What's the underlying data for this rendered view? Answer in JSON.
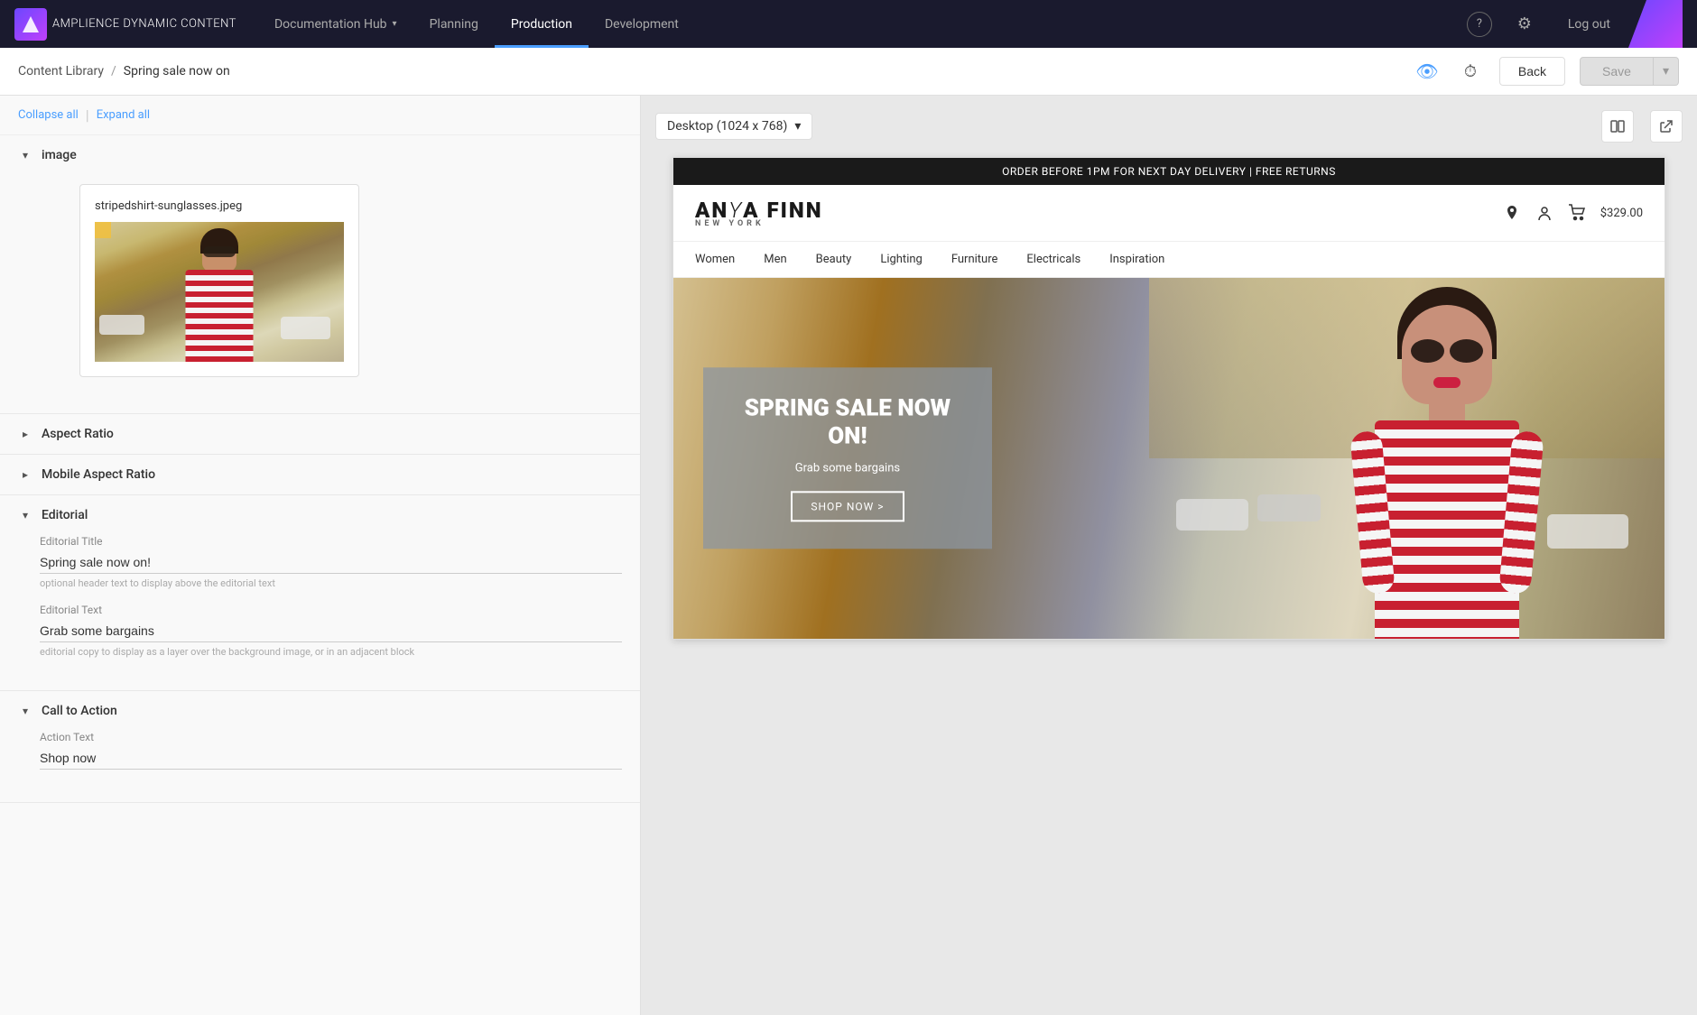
{
  "brand": {
    "name_bold": "AMPLIENCE",
    "name_light": " DYNAMIC CONTENT"
  },
  "nav": {
    "items": [
      {
        "label": "Documentation Hub",
        "active": false,
        "has_dropdown": true
      },
      {
        "label": "Planning",
        "active": false,
        "has_dropdown": false
      },
      {
        "label": "Production",
        "active": true,
        "has_dropdown": false
      },
      {
        "label": "Development",
        "active": false,
        "has_dropdown": false
      }
    ],
    "help_icon": "?",
    "settings_icon": "⚙",
    "logout_label": "Log out"
  },
  "breadcrumb": {
    "parent": "Content Library",
    "separator": "/",
    "current": "Spring sale now on",
    "back_label": "Back",
    "save_label": "Save"
  },
  "left_panel": {
    "collapse_label": "Collapse all",
    "expand_label": "Expand all",
    "sections": [
      {
        "id": "image",
        "label": "image",
        "expanded": true,
        "image_filename": "stripedshirt-sunglasses.jpeg"
      },
      {
        "id": "aspect-ratio",
        "label": "Aspect Ratio",
        "expanded": false
      },
      {
        "id": "mobile-aspect-ratio",
        "label": "Mobile Aspect Ratio",
        "expanded": false
      },
      {
        "id": "editorial",
        "label": "Editorial",
        "expanded": true,
        "fields": [
          {
            "id": "editorial-title",
            "label": "Editorial Title",
            "value": "Spring sale now on!",
            "hint": "optional header text to display above the editorial text"
          },
          {
            "id": "editorial-text",
            "label": "Editorial Text",
            "value": "Grab some bargains",
            "hint": "editorial copy to display as a layer over the background image, or in an adjacent block"
          }
        ]
      },
      {
        "id": "call-to-action",
        "label": "Call to Action",
        "expanded": true,
        "fields": [
          {
            "id": "action-text",
            "label": "Action Text",
            "value": "Shop now"
          }
        ]
      }
    ]
  },
  "preview": {
    "viewport_label": "Desktop (1024 x 768)",
    "store": {
      "announcement": "ORDER BEFORE 1PM FOR NEXT DAY DELIVERY | FREE RETURNS",
      "logo_bold": "ANY",
      "logo_light": "A FINN",
      "logo_sub": "NEW YORK",
      "cart_total": "$329.00",
      "nav_items": [
        "Women",
        "Men",
        "Beauty",
        "Lighting",
        "Furniture",
        "Electricals",
        "Inspiration"
      ],
      "hero": {
        "title": "SPRING SALE NOW ON!",
        "subtitle": "Grab some bargains",
        "cta": "SHOP NOW >"
      }
    }
  }
}
